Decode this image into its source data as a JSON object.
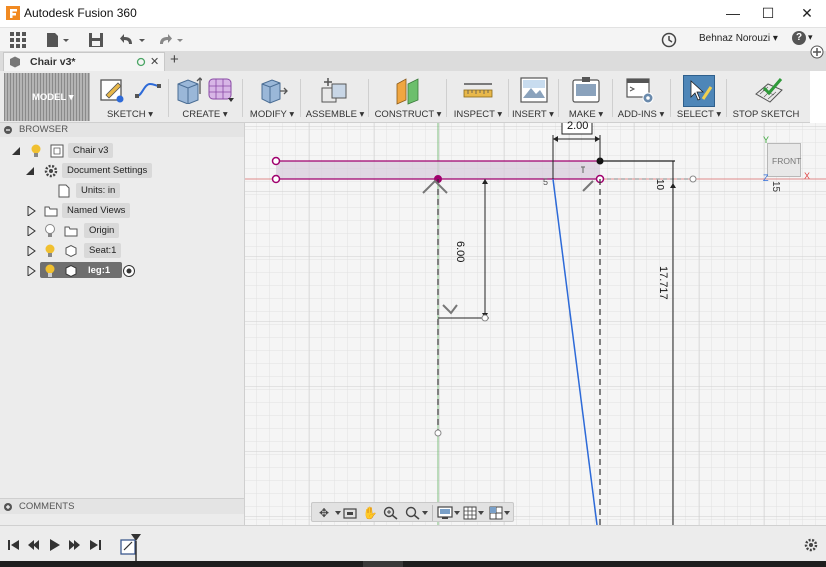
{
  "window": {
    "title": "Autodesk Fusion 360",
    "minimize_label": "—",
    "maximize_label": "☐",
    "close_label": "✕"
  },
  "quickbar": {
    "user_name": "Behnaz Norouzi ▾",
    "help_label": "?",
    "help_caret": "▾"
  },
  "tabs": {
    "active_tab_label": "Chair v3*",
    "close_label": "✕",
    "new_tab_label": "+"
  },
  "toolbar": {
    "workspace_label": "MODEL ▾",
    "groups": [
      {
        "label": "SKETCH ▾"
      },
      {
        "label": "CREATE ▾"
      },
      {
        "label": "MODIFY ▾"
      },
      {
        "label": "ASSEMBLE ▾"
      },
      {
        "label": "CONSTRUCT ▾"
      },
      {
        "label": "INSPECT ▾"
      },
      {
        "label": "INSERT ▾"
      },
      {
        "label": "MAKE ▾"
      },
      {
        "label": "ADD-INS ▾"
      },
      {
        "label": "SELECT ▾"
      },
      {
        "label": "STOP SKETCH"
      }
    ]
  },
  "browser": {
    "header": "BROWSER",
    "items": [
      {
        "label": "Chair v3"
      },
      {
        "label": "Document Settings"
      },
      {
        "label": "Units: in"
      },
      {
        "label": "Named Views"
      },
      {
        "label": "Origin"
      },
      {
        "label": "Seat:1"
      },
      {
        "label": "leg:1"
      }
    ]
  },
  "comments": {
    "header": "COMMENTS"
  },
  "viewcube": {
    "face_label": "FRONT",
    "axis_y": "Y",
    "axis_x": "X",
    "axis_z": "Z"
  },
  "sketch": {
    "dim_horizontal": "2.00",
    "dim_vertical": "6.00",
    "dim_total_height": "17.717",
    "dim_top_short": "10",
    "dim_side_label": "5",
    "ruler_label": "15"
  },
  "colors": {
    "accent_blue": "#2d6ad8",
    "sketch_magenta": "#a0006e",
    "constraint_red": "#e05050",
    "profile_fill": "#d8ccdc",
    "toolbar_bg": "#ebebeb"
  }
}
